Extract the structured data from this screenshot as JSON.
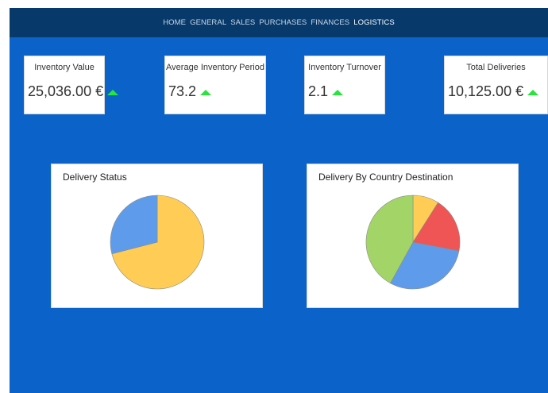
{
  "nav": {
    "items": [
      "HOME",
      "GENERAL",
      "SALES",
      "PURCHASES",
      "FINANCES",
      "LOGISTICS"
    ],
    "active": "LOGISTICS"
  },
  "kpis": [
    {
      "label": "Inventory Value",
      "value": "25,036.00 €",
      "trend_icon": "up-arrow-icon"
    },
    {
      "label": "Average Inventory Period",
      "value": "73.2",
      "trend_icon": "up-arrow-icon"
    },
    {
      "label": "Inventory Turnover",
      "value": "2.1",
      "trend_icon": "up-arrow-icon"
    },
    {
      "label": "Total Deliveries",
      "value": "10,125.00 €",
      "trend_icon": "up-arrow-icon"
    }
  ],
  "colors": {
    "background": "#0b63c9",
    "nav_bar": "#073a6b",
    "trend_up": "#27e53b"
  },
  "chart_data": [
    {
      "type": "pie",
      "title": "Delivery Status",
      "slices": [
        {
          "value": 71,
          "color": "#ffcc55"
        },
        {
          "value": 29,
          "color": "#5e9ceb"
        }
      ]
    },
    {
      "type": "pie",
      "title": "Delivery By Country Destination",
      "slices": [
        {
          "value": 9,
          "color": "#ffcc55"
        },
        {
          "value": 19,
          "color": "#ef5555"
        },
        {
          "value": 30,
          "color": "#5e9ceb"
        },
        {
          "value": 42,
          "color": "#a3d468"
        }
      ]
    }
  ]
}
